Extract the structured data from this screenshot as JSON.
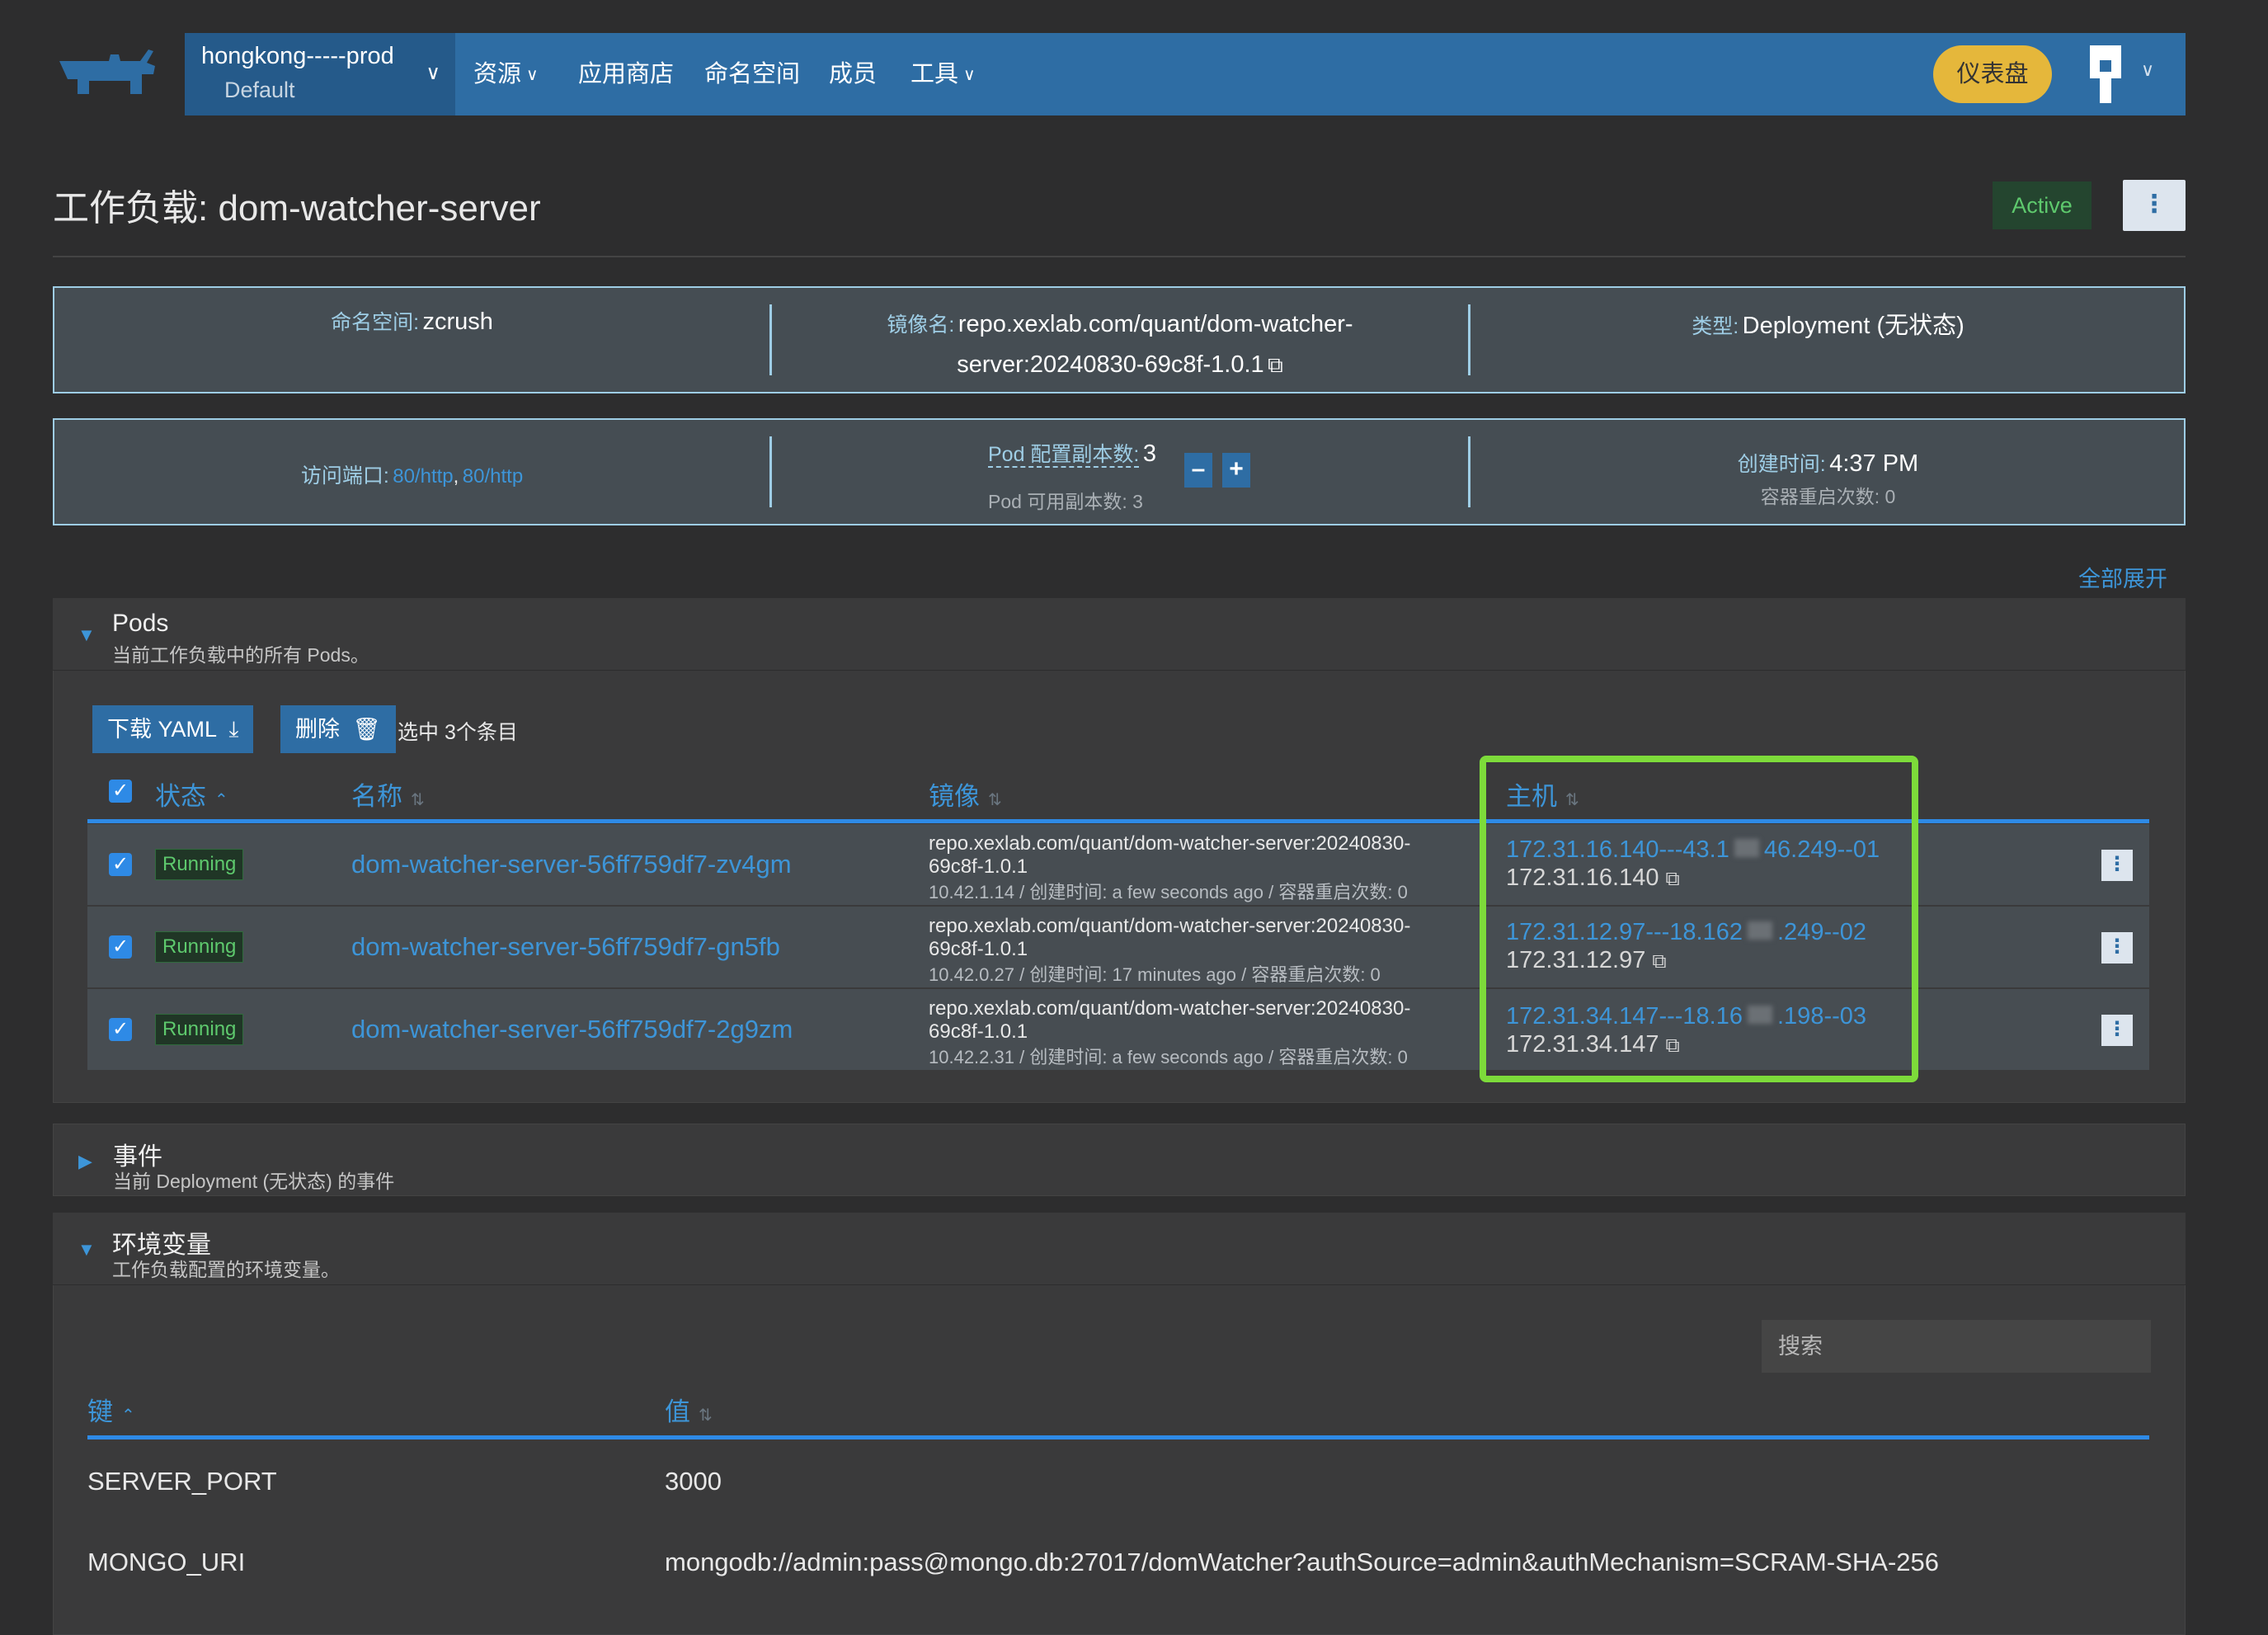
{
  "header": {
    "cluster": "hongkong-----prod",
    "project": "Default",
    "nav": [
      "资源",
      "应用商店",
      "命名空间",
      "成员",
      "工具"
    ],
    "dashboard_btn": "仪表盘"
  },
  "page": {
    "title": "工作负载: dom-watcher-server",
    "status": "Active"
  },
  "info": {
    "namespace_label": "命名空间:",
    "namespace": "zcrush",
    "image_label": "镜像名:",
    "image_line1": "repo.xexlab.com/quant/dom-watcher-",
    "image_line2": "server:20240830-69c8f-1.0.1",
    "type_label": "类型:",
    "type": "Deployment (无状态)",
    "ports_label": "访问端口:",
    "port1": "80/http",
    "port_sep": ",",
    "port2": "80/http",
    "replicas_label": "Pod 配置副本数:",
    "replicas": "3",
    "available_label": "Pod 可用副本数: 3",
    "created_label": "创建时间:",
    "created": "4:37 PM",
    "restarts_label": "容器重启次数: 0"
  },
  "expand_all": "全部展开",
  "pods": {
    "title": "Pods",
    "subtitle": "当前工作负载中的所有 Pods。",
    "download_btn": "下载 YAML",
    "delete_btn": "删除",
    "selected_text": "选中 3个条目",
    "columns": {
      "state": "状态",
      "name": "名称",
      "image": "镜像",
      "host": "主机"
    },
    "rows": [
      {
        "state": "Running",
        "name": "dom-watcher-server-56ff759df7-zv4gm",
        "image_1": "repo.xexlab.com/quant/dom-watcher-server:20240830-",
        "image_2": "69c8f-1.0.1",
        "meta": "10.42.1.14 / 创建时间: a few seconds ago / 容器重启次数: 0",
        "host_a": "172.31.16.140---43.1",
        "host_b": "46.249--01",
        "host_ip": "172.31.16.140"
      },
      {
        "state": "Running",
        "name": "dom-watcher-server-56ff759df7-gn5fb",
        "image_1": "repo.xexlab.com/quant/dom-watcher-server:20240830-",
        "image_2": "69c8f-1.0.1",
        "meta": "10.42.0.27 / 创建时间: 17 minutes ago / 容器重启次数: 0",
        "host_a": "172.31.12.97---18.162",
        "host_b": ".249--02",
        "host_ip": "172.31.12.97"
      },
      {
        "state": "Running",
        "name": "dom-watcher-server-56ff759df7-2g9zm",
        "image_1": "repo.xexlab.com/quant/dom-watcher-server:20240830-",
        "image_2": "69c8f-1.0.1",
        "meta": "10.42.2.31 / 创建时间: a few seconds ago / 容器重启次数: 0",
        "host_a": "172.31.34.147---18.16",
        "host_b": ".198--03",
        "host_ip": "172.31.34.147"
      }
    ]
  },
  "events": {
    "title": "事件",
    "subtitle": "当前 Deployment (无状态) 的事件"
  },
  "env": {
    "title": "环境变量",
    "subtitle": "工作负载配置的环境变量。",
    "search_placeholder": "搜索",
    "col_key": "键",
    "col_value": "值",
    "rows": [
      {
        "key": "SERVER_PORT",
        "value": "3000"
      },
      {
        "key": "MONGO_URI",
        "value": "mongodb://admin:pass@mongo.db:27017/domWatcher?authSource=admin&authMechanism=SCRAM-SHA-256"
      }
    ]
  }
}
